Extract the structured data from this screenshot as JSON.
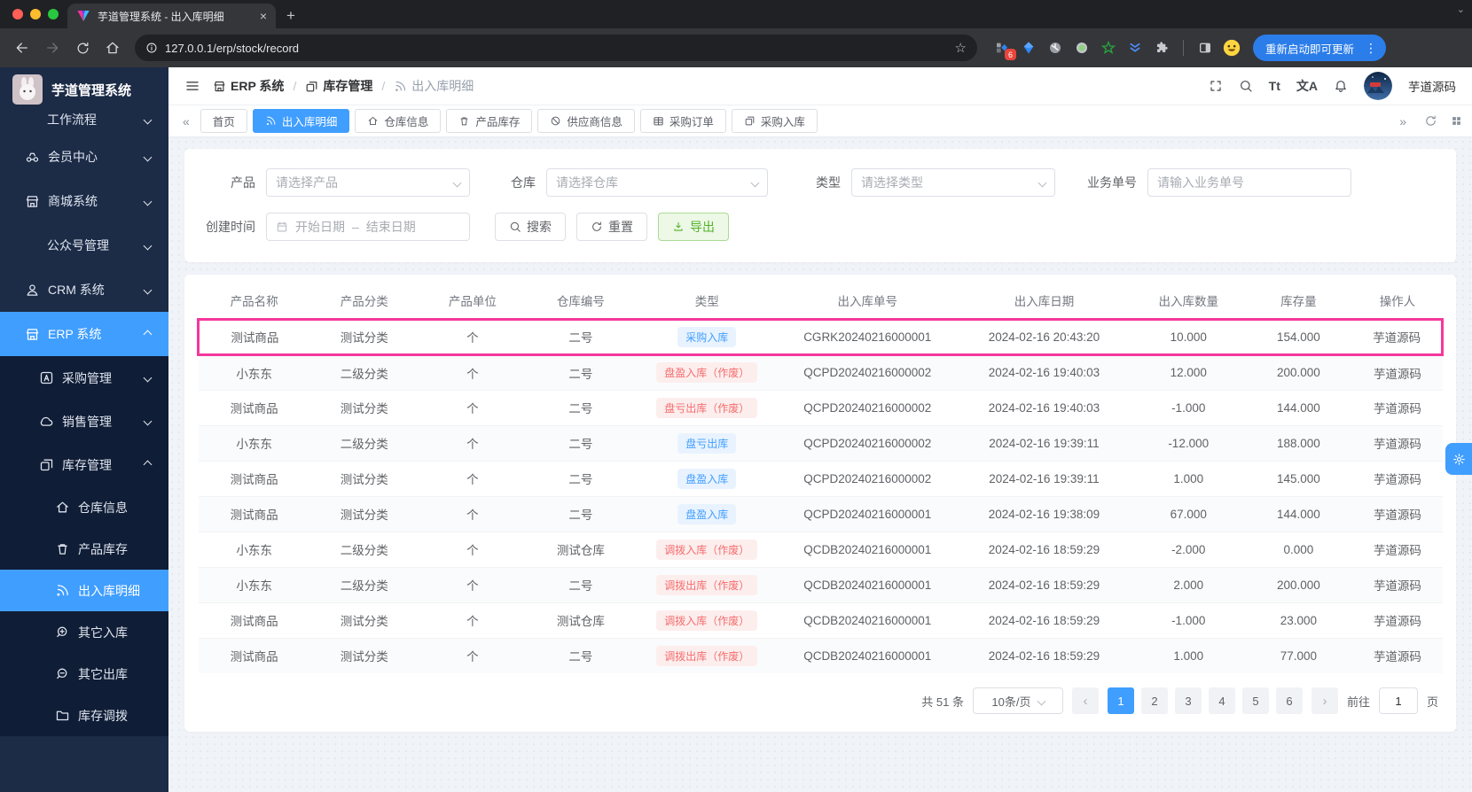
{
  "browser": {
    "tab_title": "芋道管理系统 - 出入库明细",
    "url": "127.0.0.1/erp/stock/record",
    "update_button": "重新启动即可更新",
    "extension_badge": "6"
  },
  "glyphs": {
    "plus": "+",
    "close": "×",
    "kebab": "⋮",
    "star": "☆",
    "caret": "⌄",
    "chev_double_left": "«",
    "chev_double_right": "»",
    "chev_left": "‹",
    "chev_right": "›",
    "font_size": "Tt",
    "translate": "文A",
    "separator": "/",
    "date_dash": "–"
  },
  "header": {
    "breadcrumb": [
      {
        "id": "erp",
        "icon": "storefront",
        "label": "ERP 系统"
      },
      {
        "id": "inventory",
        "icon": "squares",
        "label": "库存管理"
      },
      {
        "id": "record",
        "icon": "signal",
        "label": "出入库明细"
      }
    ],
    "user_name": "芋道源码"
  },
  "sidebar": {
    "title": "芋道管理系统",
    "items": [
      {
        "id": "workflow",
        "label": "工作流程",
        "level": 1,
        "icon": null,
        "chevron": "down"
      },
      {
        "id": "member",
        "label": "会员中心",
        "level": 1,
        "icon": "member",
        "chevron": "down"
      },
      {
        "id": "mall",
        "label": "商城系统",
        "level": 1,
        "icon": "storefront",
        "chevron": "down"
      },
      {
        "id": "mp",
        "label": "公众号管理",
        "level": 1,
        "icon": null,
        "chevron": "down"
      },
      {
        "id": "crm",
        "label": "CRM 系统",
        "level": 1,
        "icon": "person",
        "chevron": "down"
      },
      {
        "id": "erp",
        "label": "ERP 系统",
        "level": 1,
        "icon": "storefront",
        "chevron": "up",
        "active": true
      },
      {
        "id": "purchase",
        "label": "采购管理",
        "level": 2,
        "icon": "a-square",
        "chevron": "down",
        "sub": true
      },
      {
        "id": "sales",
        "label": "销售管理",
        "level": 2,
        "icon": "cloud",
        "chevron": "down",
        "sub": true
      },
      {
        "id": "stock",
        "label": "库存管理",
        "level": 2,
        "icon": "squares",
        "chevron": "up",
        "sub": true
      },
      {
        "id": "warehouse-info",
        "label": "仓库信息",
        "level": 3,
        "icon": "home",
        "sub": true
      },
      {
        "id": "product-stock",
        "label": "产品库存",
        "level": 3,
        "icon": "cup",
        "sub": true
      },
      {
        "id": "stock-record",
        "label": "出入库明细",
        "level": 3,
        "icon": "signal",
        "active": true,
        "sub": true
      },
      {
        "id": "other-in",
        "label": "其它入库",
        "level": 3,
        "icon": "zoom-in",
        "sub": true
      },
      {
        "id": "other-out",
        "label": "其它出库",
        "level": 3,
        "icon": "zoom-out",
        "sub": true
      },
      {
        "id": "stock-move",
        "label": "库存调拨",
        "level": 3,
        "icon": "folder",
        "sub": true
      }
    ]
  },
  "tabs": [
    {
      "id": "home",
      "label": "首页",
      "icon": null
    },
    {
      "id": "stock-record",
      "label": "出入库明细",
      "icon": "signal",
      "active": true
    },
    {
      "id": "warehouse-info",
      "label": "仓库信息",
      "icon": "home"
    },
    {
      "id": "product-stock",
      "label": "产品库存",
      "icon": "cup"
    },
    {
      "id": "supplier",
      "label": "供应商信息",
      "icon": "slash-circle"
    },
    {
      "id": "purchase-order",
      "label": "采购订单",
      "icon": "grid"
    },
    {
      "id": "purchase-in",
      "label": "采购入库",
      "icon": "docs"
    }
  ],
  "filters": {
    "product_label": "产品",
    "product_placeholder": "请选择产品",
    "warehouse_label": "仓库",
    "warehouse_placeholder": "请选择仓库",
    "type_label": "类型",
    "type_placeholder": "请选择类型",
    "bizno_label": "业务单号",
    "bizno_placeholder": "请输入业务单号",
    "time_label": "创建时间",
    "date_start": "开始日期",
    "date_end": "结束日期",
    "search_button": "搜索",
    "reset_button": "重置",
    "export_button": "导出"
  },
  "table": {
    "columns": [
      "产品名称",
      "产品分类",
      "产品单位",
      "仓库编号",
      "类型",
      "出入库单号",
      "出入库日期",
      "出入库数量",
      "库存量",
      "操作人"
    ],
    "rows": [
      {
        "product": "测试商品",
        "category": "测试分类",
        "unit": "个",
        "warehouse": "二号",
        "type": "采购入库",
        "variant": "blue",
        "no": "CGRK20240216000001",
        "date": "2024-02-16 20:43:20",
        "qty": "10.000",
        "stock": "154.000",
        "operator": "芋道源码",
        "highlighted": true
      },
      {
        "product": "小东东",
        "category": "二级分类",
        "unit": "个",
        "warehouse": "二号",
        "type": "盘盈入库（作废）",
        "variant": "red",
        "no": "QCPD20240216000002",
        "date": "2024-02-16 19:40:03",
        "qty": "12.000",
        "stock": "200.000",
        "operator": "芋道源码"
      },
      {
        "product": "测试商品",
        "category": "测试分类",
        "unit": "个",
        "warehouse": "二号",
        "type": "盘亏出库（作废）",
        "variant": "red",
        "no": "QCPD20240216000002",
        "date": "2024-02-16 19:40:03",
        "qty": "-1.000",
        "stock": "144.000",
        "operator": "芋道源码"
      },
      {
        "product": "小东东",
        "category": "二级分类",
        "unit": "个",
        "warehouse": "二号",
        "type": "盘亏出库",
        "variant": "blue",
        "no": "QCPD20240216000002",
        "date": "2024-02-16 19:39:11",
        "qty": "-12.000",
        "stock": "188.000",
        "operator": "芋道源码"
      },
      {
        "product": "测试商品",
        "category": "测试分类",
        "unit": "个",
        "warehouse": "二号",
        "type": "盘盈入库",
        "variant": "blue",
        "no": "QCPD20240216000002",
        "date": "2024-02-16 19:39:11",
        "qty": "1.000",
        "stock": "145.000",
        "operator": "芋道源码"
      },
      {
        "product": "测试商品",
        "category": "测试分类",
        "unit": "个",
        "warehouse": "二号",
        "type": "盘盈入库",
        "variant": "blue",
        "no": "QCPD20240216000001",
        "date": "2024-02-16 19:38:09",
        "qty": "67.000",
        "stock": "144.000",
        "operator": "芋道源码"
      },
      {
        "product": "小东东",
        "category": "二级分类",
        "unit": "个",
        "warehouse": "测试仓库",
        "type": "调拨入库（作废）",
        "variant": "red",
        "no": "QCDB20240216000001",
        "date": "2024-02-16 18:59:29",
        "qty": "-2.000",
        "stock": "0.000",
        "operator": "芋道源码"
      },
      {
        "product": "小东东",
        "category": "二级分类",
        "unit": "个",
        "warehouse": "二号",
        "type": "调拨出库（作废）",
        "variant": "red",
        "no": "QCDB20240216000001",
        "date": "2024-02-16 18:59:29",
        "qty": "2.000",
        "stock": "200.000",
        "operator": "芋道源码"
      },
      {
        "product": "测试商品",
        "category": "测试分类",
        "unit": "个",
        "warehouse": "测试仓库",
        "type": "调拨入库（作废）",
        "variant": "red",
        "no": "QCDB20240216000001",
        "date": "2024-02-16 18:59:29",
        "qty": "-1.000",
        "stock": "23.000",
        "operator": "芋道源码"
      },
      {
        "product": "测试商品",
        "category": "测试分类",
        "unit": "个",
        "warehouse": "二号",
        "type": "调拨出库（作废）",
        "variant": "red",
        "no": "QCDB20240216000001",
        "date": "2024-02-16 18:59:29",
        "qty": "1.000",
        "stock": "77.000",
        "operator": "芋道源码"
      }
    ]
  },
  "pagination": {
    "total": "共 51 条",
    "page_size": "10条/页",
    "pages": [
      "1",
      "2",
      "3",
      "4",
      "5",
      "6"
    ],
    "active_page": "1",
    "goto_label": "前往",
    "goto_value": "1",
    "page_suffix": "页"
  },
  "colors": {
    "accent": "#409eff",
    "row_highlight": "#f5379d",
    "badge_blue_bg": "#e9f3ff",
    "badge_blue_text": "#409eff",
    "badge_red_bg": "#fdeeee",
    "badge_red_text": "#f56c6c",
    "export_green": "#55b22b",
    "sidebar_bg": "#1c2b46"
  }
}
